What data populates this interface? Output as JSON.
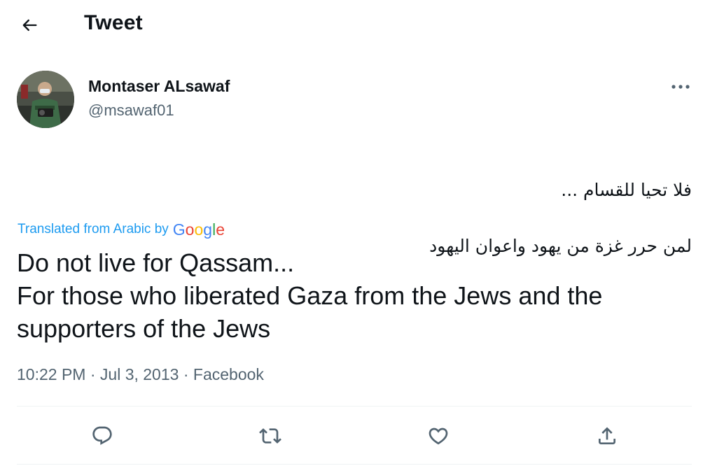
{
  "header": {
    "title": "Tweet",
    "back_icon": "arrow-left-icon"
  },
  "author": {
    "name": "Montaser ALsawaf",
    "handle": "@msawaf01",
    "avatar_icon": "avatar"
  },
  "tweet": {
    "original_lines": [
      "فلا تحيا للقسام ...",
      "لمن حرر غزة من يهود واعوان اليهود"
    ],
    "translated_prefix": "Translated from Arabic by",
    "google_letters": [
      "G",
      "o",
      "o",
      "g",
      "l",
      "e"
    ],
    "translation_lines": [
      "Do not live for Qassam...",
      "For those who liberated Gaza from the Jews and the",
      "supporters of the Jews"
    ]
  },
  "meta": {
    "time": "10:22 PM",
    "separator": "·",
    "date": "Jul 3, 2013",
    "source": "Facebook"
  },
  "actions": [
    "reply-icon",
    "retweet-icon",
    "like-icon",
    "share-icon"
  ],
  "colors": {
    "text": "#0f1419",
    "secondary": "#536471",
    "link": "#1d9bf0",
    "divider": "#eff3f4"
  }
}
